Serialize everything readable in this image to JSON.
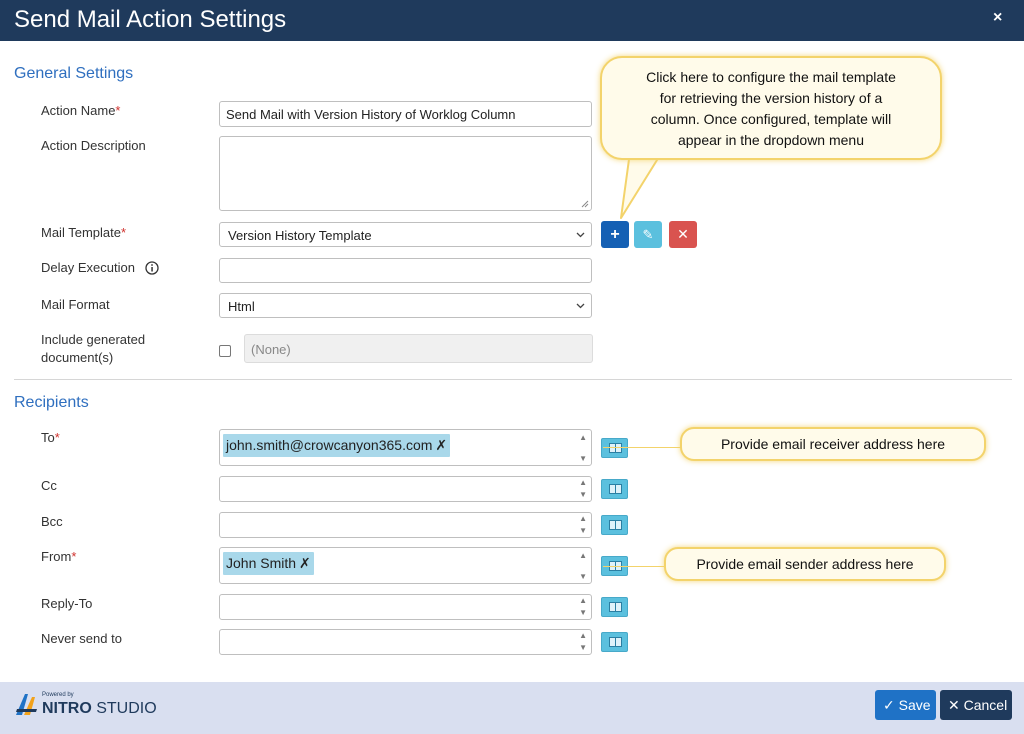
{
  "dialog": {
    "title": "Send Mail Action Settings",
    "close_glyph": "×"
  },
  "general": {
    "heading": "General Settings",
    "action_name_label": "Action Name",
    "action_name_value": "Send Mail with Version History of Worklog Column",
    "action_description_label": "Action Description",
    "action_description_value": "",
    "mail_template_label": "Mail Template",
    "mail_template_value": "Version History Template",
    "delay_execution_label": "Delay Execution",
    "delay_execution_value": "",
    "mail_format_label": "Mail Format",
    "mail_format_value": "Html",
    "include_docs_label_line1": "Include generated",
    "include_docs_label_line2": "document(s)",
    "include_docs_value": "(None)",
    "required_mark": "*"
  },
  "template_buttons": {
    "add": "+",
    "edit": "✎",
    "delete": "✕"
  },
  "recipients": {
    "heading": "Recipients",
    "to_label": "To",
    "to_token": "john.smith@crowcanyon365.com",
    "cc_label": "Cc",
    "bcc_label": "Bcc",
    "from_label": "From",
    "from_token": "John Smith",
    "reply_to_label": "Reply-To",
    "never_send_label": "Never send to",
    "token_remove_glyph": "✗",
    "spin_up": "▲",
    "spin_down": "▼"
  },
  "callouts": {
    "template_line1": "Click here to configure the mail template",
    "template_line2": "for retrieving the version history of a",
    "template_line3": "column. Once configured, template will",
    "template_line4": "appear in the dropdown menu",
    "receiver": "Provide email receiver address here",
    "sender": "Provide email sender address here"
  },
  "footer": {
    "powered_by": "Powered by",
    "brand_nitro": "NITRO",
    "brand_studio": "STUDIO",
    "save_label": "Save",
    "cancel_label": "Cancel",
    "save_glyph": "✓",
    "cancel_glyph": "✕"
  },
  "colors": {
    "title_bar": "#1f3a5c",
    "section_heading": "#2f6fbf",
    "required": "#d0312d",
    "add_button": "#1560b4",
    "edit_button": "#5bc0de",
    "delete_button": "#d9534f",
    "token": "#a9d8ea",
    "callout_border": "#f3d36b",
    "footer": "#d9dff0"
  }
}
